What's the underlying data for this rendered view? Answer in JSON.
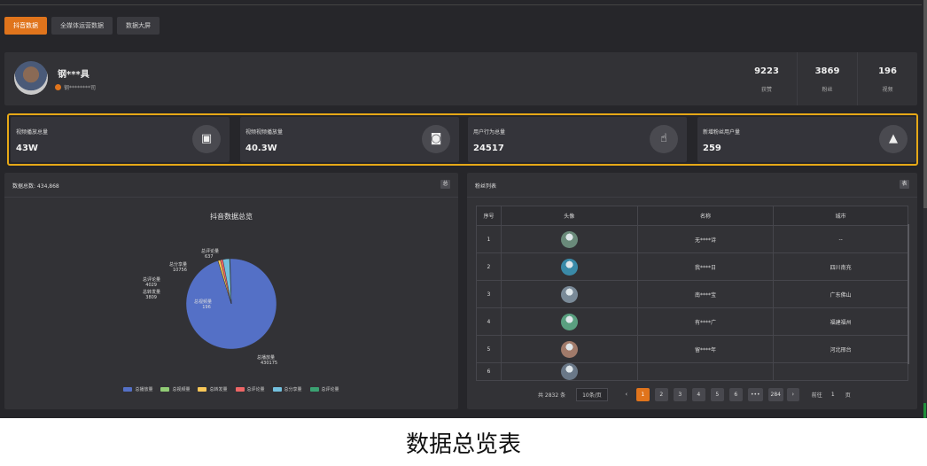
{
  "tabs": [
    {
      "label": "抖音数据"
    },
    {
      "label": "全媒体运营数据"
    },
    {
      "label": "数据大屏"
    }
  ],
  "profile": {
    "name": "钢***具",
    "company": "钢********司",
    "stats": [
      {
        "value": "9223",
        "label": "获赞"
      },
      {
        "value": "3869",
        "label": "粉丝"
      },
      {
        "value": "196",
        "label": "视频"
      }
    ]
  },
  "kpis": [
    {
      "title": "视频播放总量",
      "value": "43W",
      "icon": "video-camera-icon",
      "glyph": "▣"
    },
    {
      "title": "视频视频播放量",
      "value": "40.3W",
      "icon": "movie-camera-icon",
      "glyph": "◙"
    },
    {
      "title": "用户行为总量",
      "value": "24517",
      "icon": "hand-pointer-icon",
      "glyph": "☝"
    },
    {
      "title": "新增粉丝用户量",
      "value": "259",
      "icon": "user-icon",
      "glyph": "▲"
    }
  ],
  "left_panel": {
    "title": "数据总数: 434,868",
    "button": "总",
    "chart_data": {
      "type": "pie",
      "title": "抖音数据总览",
      "series": [
        {
          "name": "总播放量",
          "value": 430175,
          "color": "#5470c6"
        },
        {
          "name": "总视频量",
          "value": 196,
          "color": "#91cc75"
        },
        {
          "name": "总转发量",
          "value": 3809,
          "color": "#fac858"
        },
        {
          "name": "总评论量",
          "value": 4029,
          "color": "#ee6666"
        },
        {
          "name": "总分享量",
          "value": 10756,
          "color": "#73c0de"
        },
        {
          "name": "总评论量",
          "value": 637,
          "color": "#3ba272"
        }
      ],
      "legend": [
        "总播放量",
        "总视频量",
        "总转发量",
        "总评论量",
        "总分享量",
        "总评论量"
      ],
      "legend_position": "bottom"
    }
  },
  "right_panel": {
    "title": "粉丝列表",
    "button": "表",
    "columns": [
      "序号",
      "头像",
      "名称",
      "城市"
    ],
    "rows": [
      {
        "index": "1",
        "name": "无****诗",
        "city": "--",
        "avatar_color": "#6a8a7a"
      },
      {
        "index": "2",
        "name": "我****日",
        "city": "四川南充",
        "avatar_color": "#3a8aa8"
      },
      {
        "index": "3",
        "name": "南****宝",
        "city": "广东佛山",
        "avatar_color": "#7a8a98"
      },
      {
        "index": "4",
        "name": "有****广",
        "city": "福建福州",
        "avatar_color": "#5aa080"
      },
      {
        "index": "5",
        "name": "留****年",
        "city": "河北邢台",
        "avatar_color": "#a07a6a"
      },
      {
        "index": "6",
        "name": "",
        "city": "",
        "avatar_color": "#6a7888"
      }
    ],
    "pager": {
      "total": "共 2832 条",
      "size": "10条/页",
      "pages": [
        "1",
        "2",
        "3",
        "4",
        "5",
        "6",
        "•••",
        "284"
      ],
      "prev": "‹",
      "next": "›",
      "goto_label": "前往",
      "goto_value": "1",
      "goto_suffix": "页"
    }
  },
  "caption": "数据总览表"
}
